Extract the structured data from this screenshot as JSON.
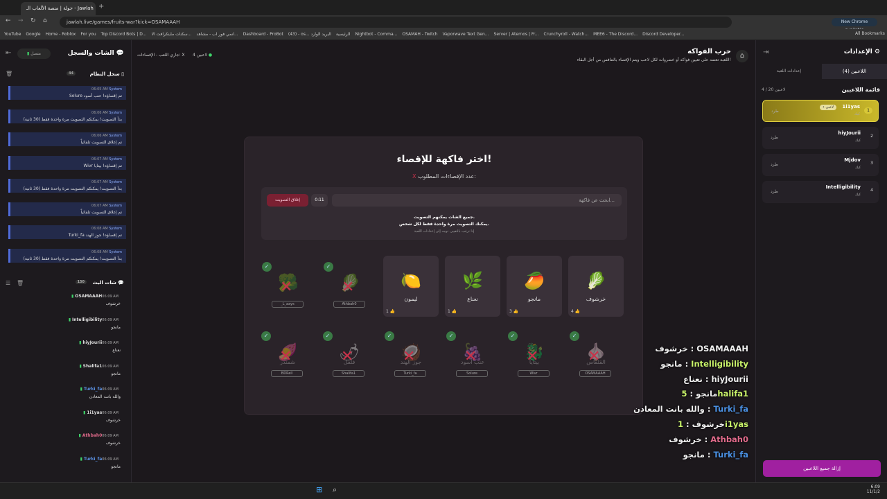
{
  "browser": {
    "tab_title": "جولة | منصة الألعاب الـ - Jawlah",
    "url": "jawlah.live/games/fruits-war?kick=OSAMAAAH",
    "chrome_badge": "New Chrome available",
    "all_bookmarks": "All Bookmarks",
    "bookmarks": [
      "YouTube",
      "Google",
      "Home - Roblox",
      "For you",
      "Top Discord Bots | D...",
      "سكنات ماينكرافت الا...",
      "انمي فور اب - مشاهد...",
      "Dashboard - ProBot",
      "(43) - os... البريد الوارد",
      "الرئيسية",
      "Nightbot - Comma...",
      "OSAMAH - Twitch",
      "Vaporwave Text Gen...",
      "Server | Aternos | Fr...",
      "Crunchyroll - Watch...",
      "MEE6 - The Discord...",
      "Discord Developer..."
    ]
  },
  "left": {
    "title": "الشات والسجل",
    "status": "متصل",
    "syslog_title": "سجل النظام",
    "syslog_count": "44",
    "stream_chat_title": "شات البث",
    "stream_chat_count": "150",
    "system": [
      {
        "time": "06:05 AM",
        "sender": "System",
        "text": "Solure تم إقصاؤه! عنب أسود"
      },
      {
        "time": "06:06 AM",
        "sender": "System",
        "text": "بدأ التصويت! يمكنكم التصويت مرة واحدة فقط (30 ثانية)"
      },
      {
        "time": "06:06 AM",
        "sender": "System",
        "text": "تم إغلاق التصويت تلقائياً"
      },
      {
        "time": "06:07 AM",
        "sender": "System",
        "text": "Wivr تم إقصاؤه! بيتايا"
      },
      {
        "time": "06:07 AM",
        "sender": "System",
        "text": "بدأ التصويت! يمكنكم التصويت مرة واحدة فقط (30 ثانية)"
      },
      {
        "time": "06:07 AM",
        "sender": "System",
        "text": "تم إغلاق التصويت تلقائياً"
      },
      {
        "time": "06:08 AM",
        "sender": "System",
        "text": "Turki_fa تم إقصاؤه! جوز الهند"
      },
      {
        "time": "06:08 AM",
        "sender": "System",
        "text": "بدأ التصويت! يمكنكم التصويت مرة واحدة فقط (30 ثانية)"
      }
    ],
    "chat": [
      {
        "time": "06:09 AM",
        "name": "OSAMAAAH",
        "color": "#dddddd",
        "text": "خرشوف"
      },
      {
        "time": "06:09 AM",
        "name": "Intelligibility",
        "color": "#dddddd",
        "text": "مانجو"
      },
      {
        "time": "06:09 AM",
        "name": "hiyJourii",
        "color": "#dddddd",
        "text": "نعناع"
      },
      {
        "time": "06:09 AM",
        "name": "Shalifa1",
        "color": "#dddddd",
        "text": "مانجو"
      },
      {
        "time": "06:09 AM",
        "name": "Turki_fa",
        "color": "#5a8fe0",
        "text": "والله بانت المعادن"
      },
      {
        "time": "06:09 AM",
        "name": "1i1yas",
        "color": "#dddddd",
        "text": "خرشوف"
      },
      {
        "time": "06:09 AM",
        "name": "Athbah0",
        "color": "#e06a8a",
        "text": "خرشوف"
      },
      {
        "time": "06:09 AM",
        "name": "Turki_fa",
        "color": "#5a8fe0",
        "text": "مانجو"
      }
    ]
  },
  "header": {
    "title": "حرب الفواكه",
    "subtitle": "اللعبة تعتمد على تعيين فواكه أو خضروات لكل لاعب ويتم الإقصاء بالتنافس من أجل البقاء!",
    "players_badge": "4 لاعبين",
    "phase_badge": "جاري اللعب - الإقصاءات: X"
  },
  "modal": {
    "title": "اختر فاكهة للإقصاء!",
    "required": "عدد الإقصاءات المطلوب:",
    "required_val": "X",
    "search_placeholder": "ابحث عن فاكهة...",
    "timer": "0:11",
    "close_vote": "إغلاق التصويت",
    "info1": "جميع الشات يمكنهم التصويت.",
    "info2": "يمكنك التصويت مرة واحدة فقط لكل شخص.",
    "info3": "إذا ترغب بالتغيير، توجه إلى إعدادات اللعبة",
    "active": [
      {
        "name": "خرشوف",
        "emoji": "🥬",
        "count": "4"
      },
      {
        "name": "مانجو",
        "emoji": "🥭",
        "count": "3"
      },
      {
        "name": "نعناع",
        "emoji": "🌿",
        "count": "1"
      },
      {
        "name": "ليمون",
        "emoji": "🍋",
        "count": "1"
      }
    ],
    "out_top": [
      {
        "emoji": "🥬",
        "player": "Athbah0"
      },
      {
        "emoji": "🥦",
        "player": "_L_aays"
      }
    ],
    "out_bottom": [
      {
        "name": "القلقاس",
        "emoji": "🧄",
        "player": "OSAMAAAH"
      },
      {
        "name": "بيتايا",
        "emoji": "🐉",
        "player": "Wivr"
      },
      {
        "name": "عنب أسود",
        "emoji": "🍇",
        "player": "Solure"
      },
      {
        "name": "جوز الهند",
        "emoji": "🥥",
        "player": "Turki_fa"
      },
      {
        "name": "فلفل",
        "emoji": "🌶",
        "player": "Shalifa1"
      },
      {
        "name": "شمندر",
        "emoji": "🍠",
        "player": "BDRell"
      }
    ]
  },
  "right": {
    "title": "الإعدادات",
    "tab_players": "اللاعبين (4)",
    "tab_settings": "إعدادات اللعبة",
    "list_title": "قائمة اللاعبين",
    "count": "4 / 20 لاعبين",
    "kick": "طرد",
    "role": "كيك",
    "me_badge": "• لاعبي",
    "remove_all": "إزالة جميع اللاعبين",
    "players": [
      {
        "num": "1",
        "name": "1i1yas"
      },
      {
        "num": "2",
        "name": "hiyJourii"
      },
      {
        "num": "3",
        "name": "Mjdov"
      },
      {
        "num": "4",
        "name": "Intelligibility"
      }
    ]
  },
  "overlay": [
    {
      "name": "OSAMAAAH",
      "color": "#eeeeee",
      "text": "خرشوف"
    },
    {
      "name": "Intelligibility",
      "color": "#c9f36a",
      "text": "مانجو"
    },
    {
      "name": "hiyJourii",
      "color": "#eeeeee",
      "text": "نعناع"
    },
    {
      "name": "5halifa1",
      "color": "#c9f36a",
      "text": "مانجو"
    },
    {
      "name": "Turki_fa",
      "color": "#4a90e2",
      "text": "والله بانت المعادن"
    },
    {
      "name": "1i1yas",
      "color": "#c9f36a",
      "text": "خرشوف"
    },
    {
      "name": "Athbah0",
      "color": "#e06a8a",
      "text": "خرشوف"
    },
    {
      "name": "Turki_fa",
      "color": "#4a90e2",
      "text": "مانجو"
    }
  ],
  "taskbar": {
    "time": "6:09",
    "date": "11/1/2"
  }
}
